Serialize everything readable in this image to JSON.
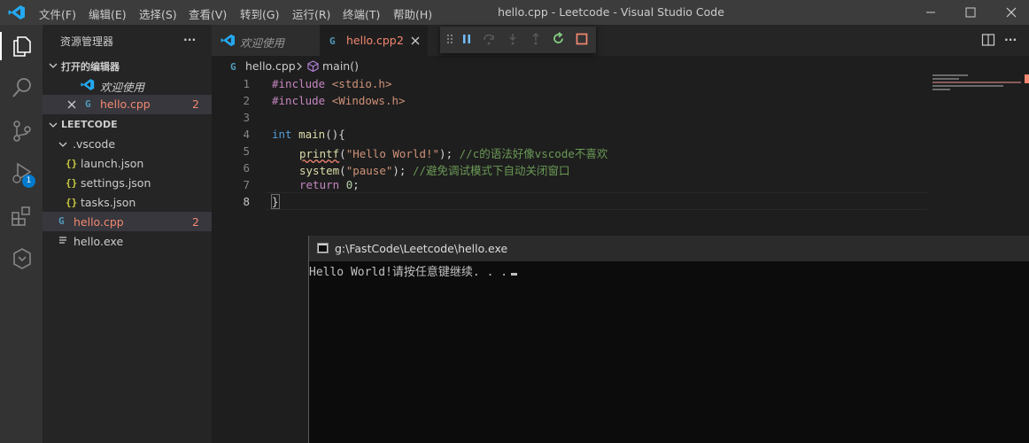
{
  "window": {
    "title": "hello.cpp - Leetcode - Visual Studio Code",
    "menu": [
      "文件(F)",
      "编辑(E)",
      "选择(S)",
      "查看(V)",
      "转到(G)",
      "运行(R)",
      "终端(T)",
      "帮助(H)"
    ]
  },
  "activity_bar": {
    "items": [
      "explorer-icon",
      "search-icon",
      "source-control-icon",
      "run-debug-icon",
      "extensions-icon",
      "remote-icon"
    ],
    "debug_badge": "1"
  },
  "sidebar": {
    "title": "资源管理器",
    "more": "···",
    "open_editors_header": "打开的编辑器",
    "open_editors": [
      {
        "name": "欢迎使用",
        "icon": "vscode-icon"
      },
      {
        "name": "hello.cpp",
        "icon": "cpp-icon",
        "problems": "2"
      }
    ],
    "folder_header": "LEETCODE",
    "tree": [
      {
        "name": ".vscode",
        "type": "folder"
      },
      {
        "name": "launch.json",
        "icon": "{}"
      },
      {
        "name": "settings.json",
        "icon": "{}"
      },
      {
        "name": "tasks.json",
        "icon": "{}"
      },
      {
        "name": "hello.cpp",
        "icon": "cpp",
        "problems": "2"
      },
      {
        "name": "hello.exe",
        "icon": "file"
      }
    ]
  },
  "tabs": [
    {
      "label": "欢迎使用"
    },
    {
      "label": "hello.cpp",
      "problems": "2"
    }
  ],
  "debug_toolbar": [
    "grip-icon",
    "pause-icon",
    "step-over-icon",
    "step-into-icon",
    "step-out-icon",
    "restart-icon",
    "stop-icon"
  ],
  "breadcrumb": {
    "file": "hello.cpp",
    "symbol": "main()"
  },
  "editor": {
    "line_numbers": [
      "1",
      "2",
      "3",
      "4",
      "5",
      "6",
      "7",
      "8"
    ],
    "lines": {
      "l1_kw": "#include",
      "l1_hdr": "<stdio.h>",
      "l2_kw": "#include",
      "l2_hdr": "<Windows.h>",
      "l4_type": "int",
      "l4_fn": "main",
      "l4_rest": "(){",
      "l5_fn": "printf",
      "l5_open": "(",
      "l5_str": "\"Hello World!\"",
      "l5_close": ");",
      "l5_cmt": "//c的语法好像vscode不喜欢",
      "l6_fn": "system",
      "l6_open": "(",
      "l6_str": "\"pause\"",
      "l6_close": ");",
      "l6_cmt": "//避免调试模式下自动关闭窗口",
      "l7_kw": "return",
      "l7_num": "0",
      "l7_end": ";",
      "l8": "}"
    }
  },
  "console": {
    "title": "g:\\FastCode\\Leetcode\\hello.exe",
    "output": "Hello World!请按任意键继续. . ."
  },
  "colors": {
    "accent": "#007acc",
    "error": "#f48771"
  }
}
